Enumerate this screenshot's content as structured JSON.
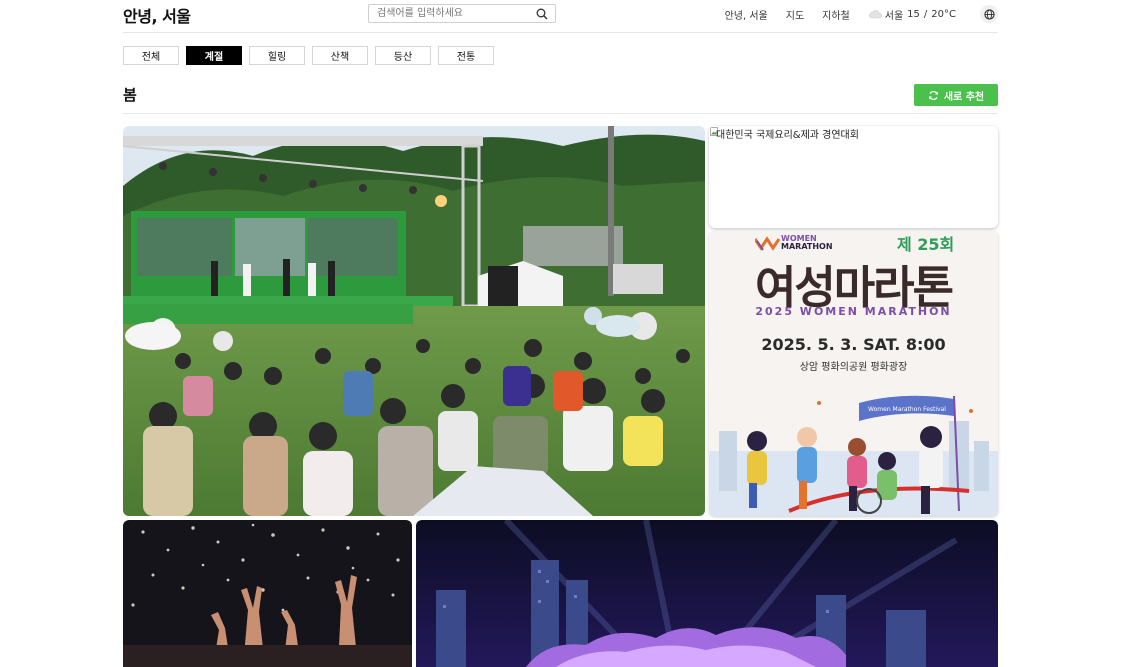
{
  "header": {
    "logo": "안녕, 서울",
    "search_placeholder": "검색어를 입력하세요",
    "nav": [
      "안녕, 서울",
      "지도",
      "지하철"
    ],
    "weather": {
      "city": "서울",
      "low": "15",
      "sep": "/",
      "high": "20°C"
    }
  },
  "tabs": [
    "전체",
    "계절",
    "힐링",
    "산책",
    "등산",
    "전통"
  ],
  "active_tab": "계절",
  "section": {
    "title": "봄",
    "refresh_label": "새로 추천"
  },
  "cards": {
    "broken_alt": "대한민국 국제요리&제과 경연대회",
    "marathon": {
      "logo_line1": "WOMEN",
      "logo_line2": "MARATHON",
      "edition": "제 25회",
      "title": "여성마라톤",
      "subtitle": "2025 WOMEN MARATHON",
      "date": "2025. 5. 3. SAT. 8:00",
      "place": "상암 평화의공원 평화광장",
      "banner": "Women Marathon Festival"
    }
  },
  "colors": {
    "accent_green": "#4cc04c",
    "active_tab": "#000000"
  }
}
